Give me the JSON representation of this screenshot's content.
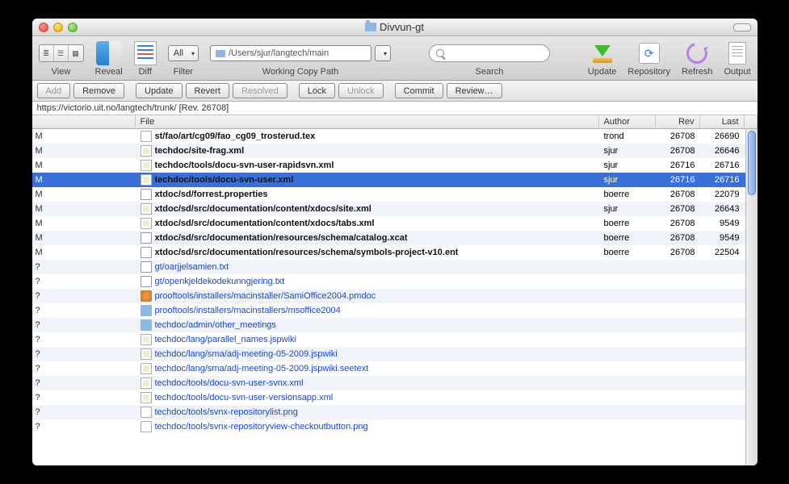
{
  "window": {
    "title": "Divvun-gt"
  },
  "toolbar": {
    "view": "View",
    "reveal": "Reveal",
    "diff": "Diff",
    "filter": "Filter",
    "filter_combo": "All",
    "wcpath_label": "Working Copy Path",
    "wcpath_value": "/Users/sjur/langtech/main",
    "search": "Search",
    "update": "Update",
    "repository": "Repository",
    "refresh": "Refresh",
    "output": "Output"
  },
  "actions": {
    "add": "Add",
    "remove": "Remove",
    "update": "Update",
    "revert": "Revert",
    "resolved": "Resolved",
    "lock": "Lock",
    "unlock": "Unlock",
    "commit": "Commit",
    "review": "Review…"
  },
  "pathbar": "https://victorio.uit.no/langtech/trunk/  [Rev. 26708]",
  "columns": {
    "file": "File",
    "author": "Author",
    "rev": "Rev",
    "last": "Last"
  },
  "rows": [
    {
      "status": "M",
      "icon": "doc",
      "file": "st/fao/art/cg09/fao_cg09_trosterud.tex",
      "author": "trond",
      "rev": "26708",
      "last": "26690",
      "link": false
    },
    {
      "status": "M",
      "icon": "xml",
      "file": "techdoc/site-frag.xml",
      "author": "sjur",
      "rev": "26708",
      "last": "26646",
      "link": false
    },
    {
      "status": "M",
      "icon": "xml",
      "file": "techdoc/tools/docu-svn-user-rapidsvn.xml",
      "author": "sjur",
      "rev": "26716",
      "last": "26716",
      "link": false
    },
    {
      "status": "M",
      "icon": "xml",
      "file": "techdoc/tools/docu-svn-user.xml",
      "author": "sjur",
      "rev": "26716",
      "last": "26716",
      "link": false,
      "selected": true
    },
    {
      "status": "M",
      "icon": "txt",
      "file": "xtdoc/sd/forrest.properties",
      "author": "boerre",
      "rev": "26708",
      "last": "22079",
      "link": false
    },
    {
      "status": "M",
      "icon": "xml",
      "file": "xtdoc/sd/src/documentation/content/xdocs/site.xml",
      "author": "sjur",
      "rev": "26708",
      "last": "26643",
      "link": false
    },
    {
      "status": "M",
      "icon": "xml",
      "file": "xtdoc/sd/src/documentation/content/xdocs/tabs.xml",
      "author": "boerre",
      "rev": "26708",
      "last": "9549",
      "link": false
    },
    {
      "status": "M",
      "icon": "txt",
      "file": "xtdoc/sd/src/documentation/resources/schema/catalog.xcat",
      "author": "boerre",
      "rev": "26708",
      "last": "9549",
      "link": false
    },
    {
      "status": "M",
      "icon": "txt",
      "file": "xtdoc/sd/src/documentation/resources/schema/symbols-project-v10.ent",
      "author": "boerre",
      "rev": "26708",
      "last": "22504",
      "link": false
    },
    {
      "status": "?",
      "icon": "txt",
      "file": "gt/oarjjelsamien.txt",
      "author": "",
      "rev": "",
      "last": "",
      "link": true
    },
    {
      "status": "?",
      "icon": "txt",
      "file": "gt/openkjeldekodekunngjering.txt",
      "author": "",
      "rev": "",
      "last": "",
      "link": true
    },
    {
      "status": "?",
      "icon": "pkg",
      "file": "prooftools/installers/macinstaller/SamiOffice2004.pmdoc",
      "author": "",
      "rev": "",
      "last": "",
      "link": true
    },
    {
      "status": "?",
      "icon": "folder",
      "file": "prooftools/installers/macinstallers/msoffice2004",
      "author": "",
      "rev": "",
      "last": "",
      "link": true
    },
    {
      "status": "?",
      "icon": "folder",
      "file": "techdoc/admin/other_meetings",
      "author": "",
      "rev": "",
      "last": "",
      "link": true
    },
    {
      "status": "?",
      "icon": "xml",
      "file": "techdoc/lang/parallel_names.jspwiki",
      "author": "",
      "rev": "",
      "last": "",
      "link": true
    },
    {
      "status": "?",
      "icon": "xml",
      "file": "techdoc/lang/sma/adj-meeting-05-2009.jspwiki",
      "author": "",
      "rev": "",
      "last": "",
      "link": true
    },
    {
      "status": "?",
      "icon": "xml",
      "file": "techdoc/lang/sma/adj-meeting-05-2009.jspwiki.seetext",
      "author": "",
      "rev": "",
      "last": "",
      "link": true
    },
    {
      "status": "?",
      "icon": "xml",
      "file": "techdoc/tools/docu-svn-user-svnx.xml",
      "author": "",
      "rev": "",
      "last": "",
      "link": true
    },
    {
      "status": "?",
      "icon": "xml",
      "file": "techdoc/tools/docu-svn-user-versionsapp.xml",
      "author": "",
      "rev": "",
      "last": "",
      "link": true
    },
    {
      "status": "?",
      "icon": "png",
      "file": "techdoc/tools/svnx-repositorylist.png",
      "author": "",
      "rev": "",
      "last": "",
      "link": true
    },
    {
      "status": "?",
      "icon": "png",
      "file": "techdoc/tools/svnx-repositoryview-checkoutbutton.png",
      "author": "",
      "rev": "",
      "last": "",
      "link": true
    }
  ]
}
